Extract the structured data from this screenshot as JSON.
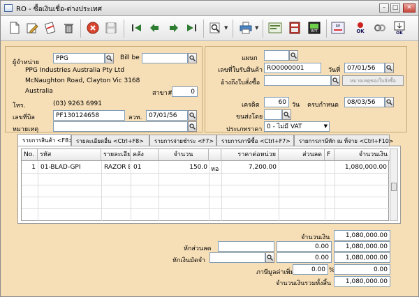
{
  "window": {
    "title": "RO - ซื้อเงินเชื่อ-ต่างประเทศ",
    "min": "–",
    "max": "□",
    "close": "✕"
  },
  "toolbar": {
    "buttons": [
      "new-icon",
      "edit-icon",
      "print-doc-icon",
      "delete-icon",
      "cancel-icon",
      "save-icon",
      "first-icon",
      "prev-icon",
      "next-icon",
      "last-icon",
      "search-icon",
      "printer-icon",
      "export-icon",
      "calculator-icon",
      "report-icon",
      "refresh-icon",
      "ok-icon",
      "settings-icon",
      "exit-icon"
    ]
  },
  "header": {
    "supplier_label": "ผู้จำหน่าย",
    "supplier_code": "PPG",
    "billbe_label": "Bill be",
    "billbe_value": "",
    "supplier_name": "PPG Industries Australia Pty Ltd",
    "address1": "McNaughton Road, Clayton Vic 3168",
    "address2": "Australia",
    "branch_label": "สาขา#",
    "branch_value": "0",
    "tel_label": "โทร.",
    "tel_value": "(03) 9263 6991",
    "bill_no_label": "เลขที่บิล",
    "bill_no_value": "PF130124658",
    "bill_date_label": "ลวท.",
    "bill_date_value": "07/01/56",
    "remark_label": "หมายเหตุ",
    "remark_value": "",
    "dept_label": "แผนก",
    "dept_value": "",
    "receipt_no_label": "เลขที่ใบรับสินค้า",
    "receipt_no_value": "RO0000001",
    "date_label": "วันที่",
    "date_value": "07/01/56",
    "po_ref_label": "อ้างถึงใบสั่งซื้อ",
    "po_ref_value": "",
    "po_remark_button": "หมายเหตุของใบสั่งซื้อ",
    "credit_label": "เครดิต",
    "credit_value": "60",
    "credit_unit": "วัน",
    "due_label": "ครบกำหนด",
    "due_value": "08/03/56",
    "ship_label": "ขนส่งโดย",
    "ship_value": "",
    "price_type_label": "ประเภทราคา",
    "price_type_value": "0 - ไม่มี VAT"
  },
  "tabs": [
    "รายการสินค้า <F8>",
    "รายละเอียดอื่น <Ctrl+F8>",
    "รายการจ่ายชำระ <F7>",
    "รายการภาษีซื้อ <Ctrl+F7>",
    "รายการภาษีหัก ณ ที่จ่าย <Ctrl+F10>"
  ],
  "grid": {
    "columns": [
      "No.",
      "รหัส",
      "รายละเอียด",
      "คลัง",
      "จำนวน",
      "",
      "ราคาต่อหน่วย",
      "ส่วนลด",
      "F",
      "จำนวนเงิน"
    ],
    "rows": [
      {
        "no": "1",
        "code": "01-BLAD-GPI",
        "desc": "RAZOR BLADE",
        "wh": "01",
        "qty": "150.0",
        "unit": "หอ",
        "price": "7,200.00",
        "disc": "",
        "f": "",
        "amount": "1,080,000.00"
      }
    ]
  },
  "totals": {
    "amount_label": "จำนวนเงิน",
    "amount_value": "1,080,000.00",
    "discount_label": "หักส่วนลด",
    "discount_input": "",
    "discount_value": "0.00",
    "discount_total": "1,080,000.00",
    "deposit_label": "หักเงินมัดจำ",
    "deposit_input": "",
    "deposit_value": "0.00",
    "deposit_total": "1,080,000.00",
    "vat_label": "ภาษีมูลค่าเพิ่ม",
    "vat_rate": "0.00",
    "vat_pct": "%",
    "vat_value": "0.00",
    "grand_label": "จำนวนเงินรวมทั้งสิ้น",
    "grand_value": "1,080,000.00"
  }
}
